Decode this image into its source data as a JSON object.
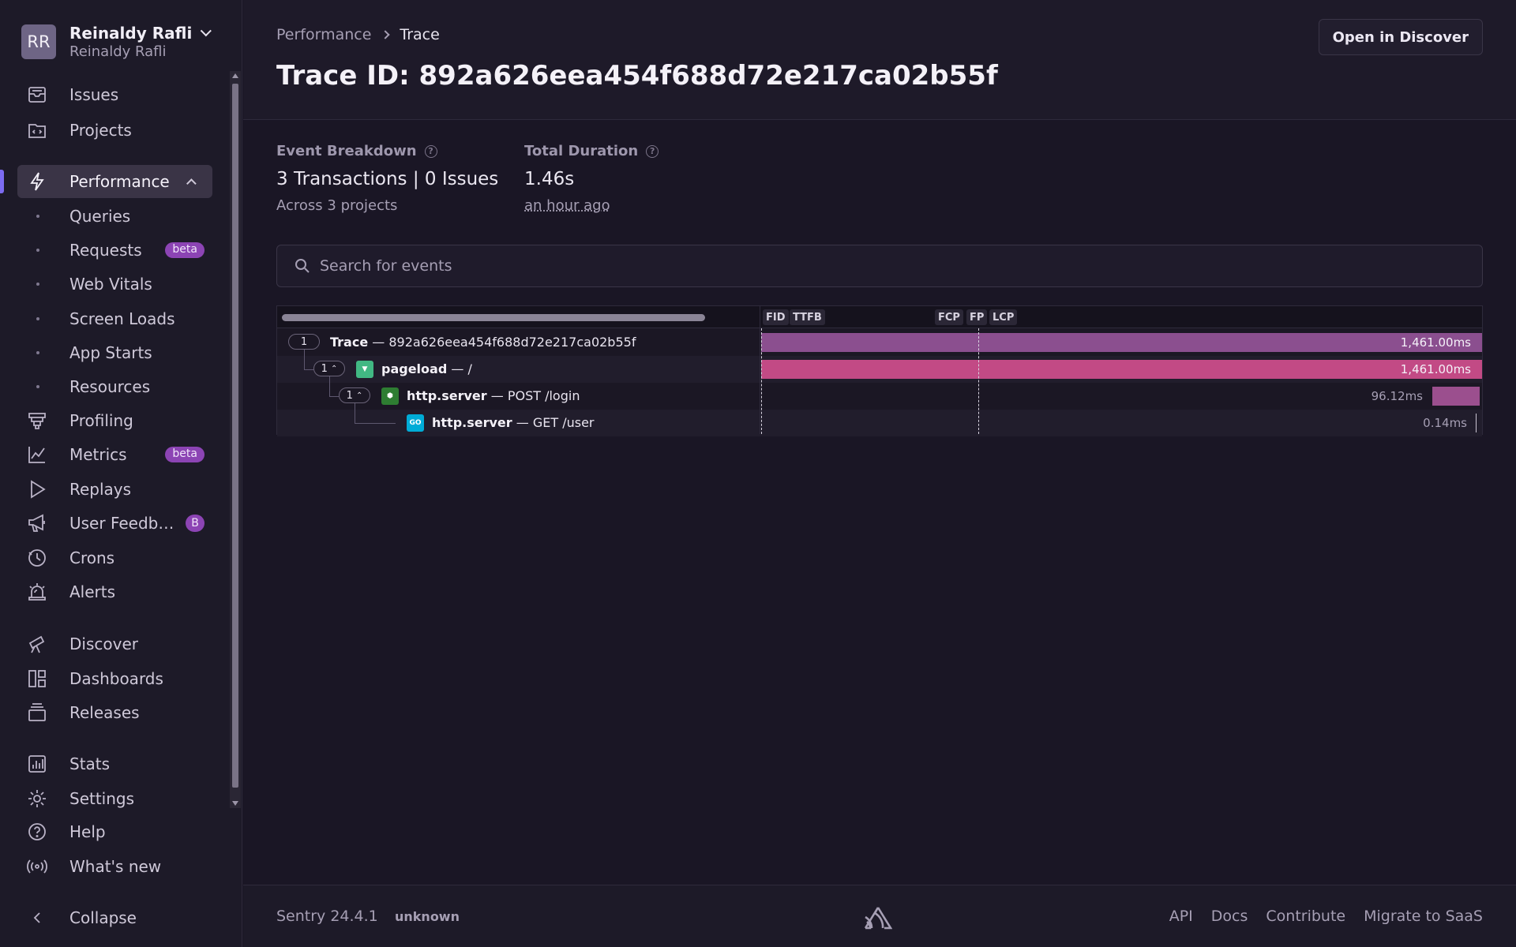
{
  "org": {
    "initials": "RR",
    "name": "Reinaldy Rafli",
    "user": "Reinaldy Rafli"
  },
  "sidebar": {
    "items": [
      {
        "label": "Issues",
        "icon": "issues-icon"
      },
      {
        "label": "Projects",
        "icon": "projects-icon"
      },
      {
        "label": "Performance",
        "icon": "performance-icon"
      },
      {
        "label": "Profiling",
        "icon": "profiling-icon"
      },
      {
        "label": "Metrics",
        "icon": "metrics-icon",
        "badge": "beta"
      },
      {
        "label": "Replays",
        "icon": "replays-icon"
      },
      {
        "label": "User Feedb…",
        "icon": "megaphone-icon",
        "badge": "B"
      },
      {
        "label": "Crons",
        "icon": "crons-icon"
      },
      {
        "label": "Alerts",
        "icon": "alerts-icon"
      },
      {
        "label": "Discover",
        "icon": "telescope-icon"
      },
      {
        "label": "Dashboards",
        "icon": "dashboards-icon"
      },
      {
        "label": "Releases",
        "icon": "releases-icon"
      },
      {
        "label": "Stats",
        "icon": "stats-icon"
      },
      {
        "label": "Settings",
        "icon": "gear-icon"
      },
      {
        "label": "Help",
        "icon": "help-icon"
      },
      {
        "label": "What's new",
        "icon": "broadcast-icon"
      },
      {
        "label": "Collapse",
        "icon": "chevron-left-icon"
      }
    ],
    "sub_items": [
      {
        "label": "Queries"
      },
      {
        "label": "Requests",
        "badge": "beta"
      },
      {
        "label": "Web Vitals"
      },
      {
        "label": "Screen Loads"
      },
      {
        "label": "App Starts"
      },
      {
        "label": "Resources"
      }
    ]
  },
  "header": {
    "breadcrumb": [
      "Performance",
      "Trace"
    ],
    "title": "Trace ID: 892a626eea454f688d72e217ca02b55f",
    "open_button": "Open in Discover"
  },
  "meta": {
    "breakdown_label": "Event Breakdown",
    "breakdown_value": "3 Transactions | 0 Issues",
    "breakdown_sub": "Across 3 projects",
    "duration_label": "Total Duration",
    "duration_value": "1.46s",
    "duration_sub": "an hour ago"
  },
  "search": {
    "placeholder": "Search for events"
  },
  "trace": {
    "vitals": [
      "FID",
      "TTFB",
      "FCP",
      "FP",
      "LCP"
    ],
    "rows": [
      {
        "count": "1",
        "op": "Trace",
        "desc": " — 892a626eea454f688d72e217ca02b55f",
        "duration": "1,461.00ms",
        "color": "#8b4f8f"
      },
      {
        "count": "1",
        "op": "pageload",
        "desc": " — /",
        "duration": "1,461.00ms",
        "color": "#c24a85",
        "platform": "vue-icon"
      },
      {
        "count": "1",
        "op": "http.server",
        "desc": " — POST /login",
        "duration": "96.12ms",
        "color": "#9b4f8e",
        "platform": "node-icon"
      },
      {
        "op": "http.server",
        "desc": " — GET /user",
        "duration": "0.14ms",
        "color": "#c9c4d2",
        "platform": "go-icon",
        "platform_text": "GO"
      }
    ]
  },
  "footer": {
    "version": "Sentry 24.4.1",
    "build": "unknown",
    "links": [
      "API",
      "Docs",
      "Contribute",
      "Migrate to SaaS"
    ]
  }
}
